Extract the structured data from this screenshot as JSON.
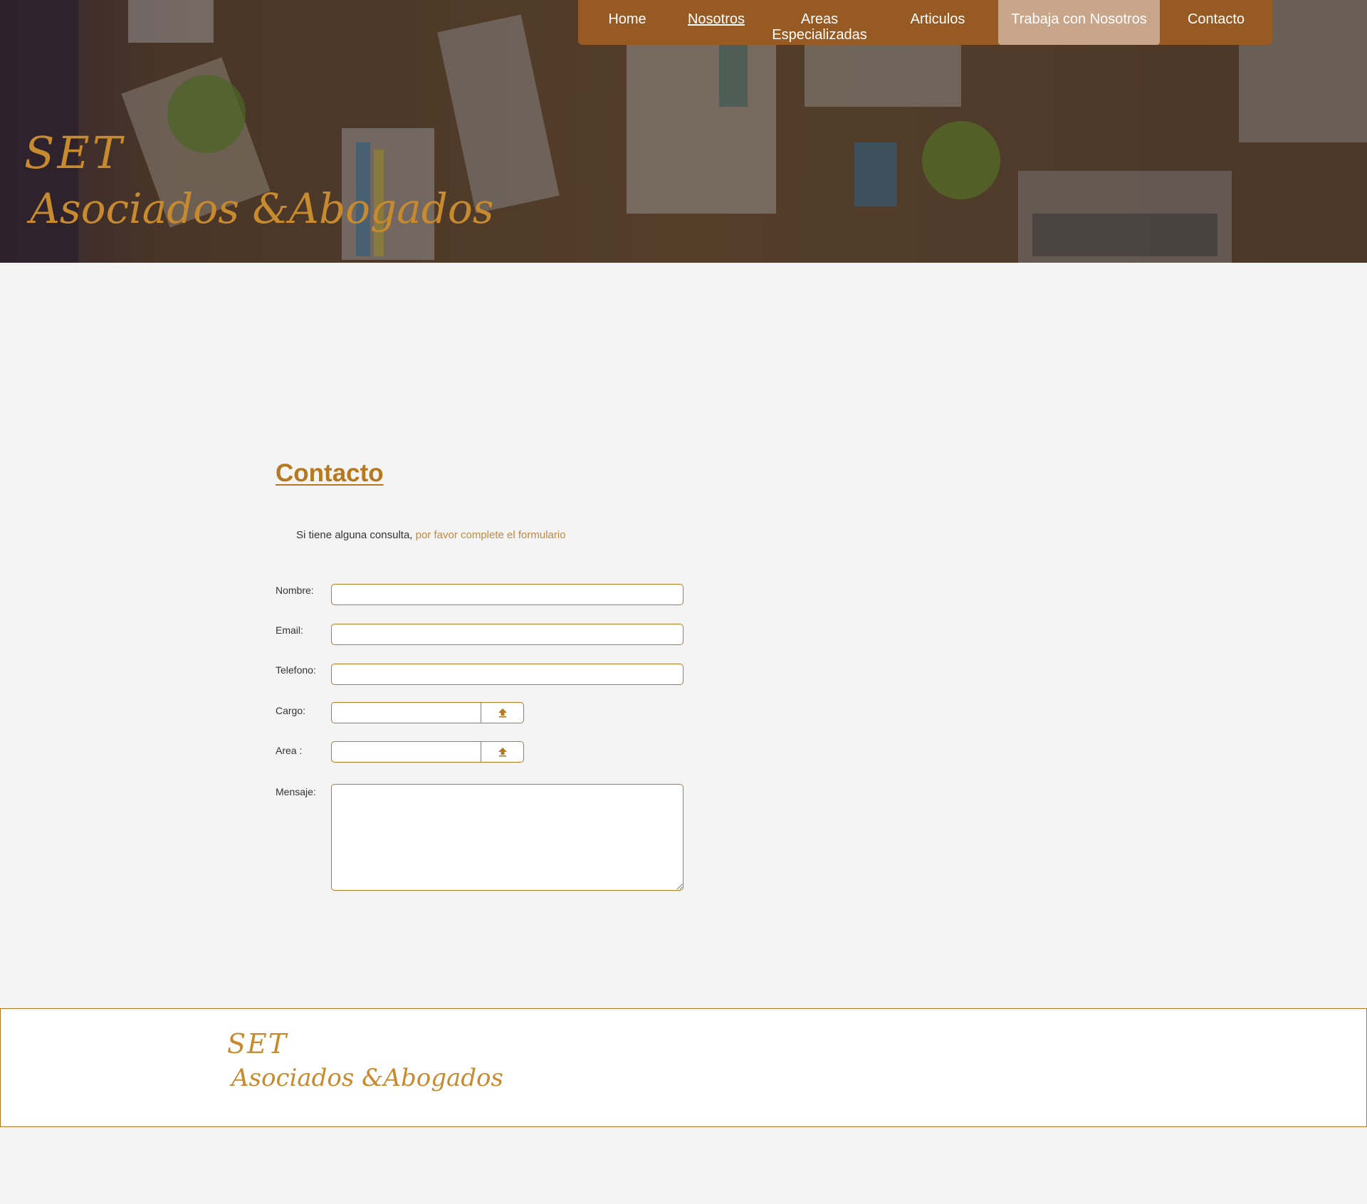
{
  "brand": {
    "line1": "SET",
    "line2": "Asociados &Abogados",
    "color": "#c78a2e"
  },
  "nav": {
    "items": [
      {
        "label": "Home"
      },
      {
        "label": "Nosotros"
      },
      {
        "label": "Areas Especializadas"
      },
      {
        "label": "Articulos"
      },
      {
        "label": "Trabaja con Nosotros"
      },
      {
        "label": "Contacto"
      }
    ],
    "current": "Nosotros",
    "highlighted": "Trabaja con Nosotros",
    "background": "#975a22"
  },
  "contact": {
    "title": "Contacto",
    "intro_prefix": "Si tiene alguna consulta,",
    "intro_accent": "por favor complete el formulario",
    "form": {
      "nombre_label": "Nombre:",
      "email_label": "Email:",
      "telefono_label": "Telefono:",
      "cargo_label": "Cargo:",
      "area_label": "Area :",
      "mensaje_label": "Mensaje:",
      "nombre_value": "",
      "email_value": "",
      "telefono_value": "",
      "mensaje_value": "",
      "upload_icon": "upload-arrow-icon"
    }
  },
  "footer": {
    "line1": "SET",
    "line2": "Asociados &Abogados"
  },
  "colors": {
    "accent": "#b7791f",
    "background": "#f4f4f4"
  }
}
